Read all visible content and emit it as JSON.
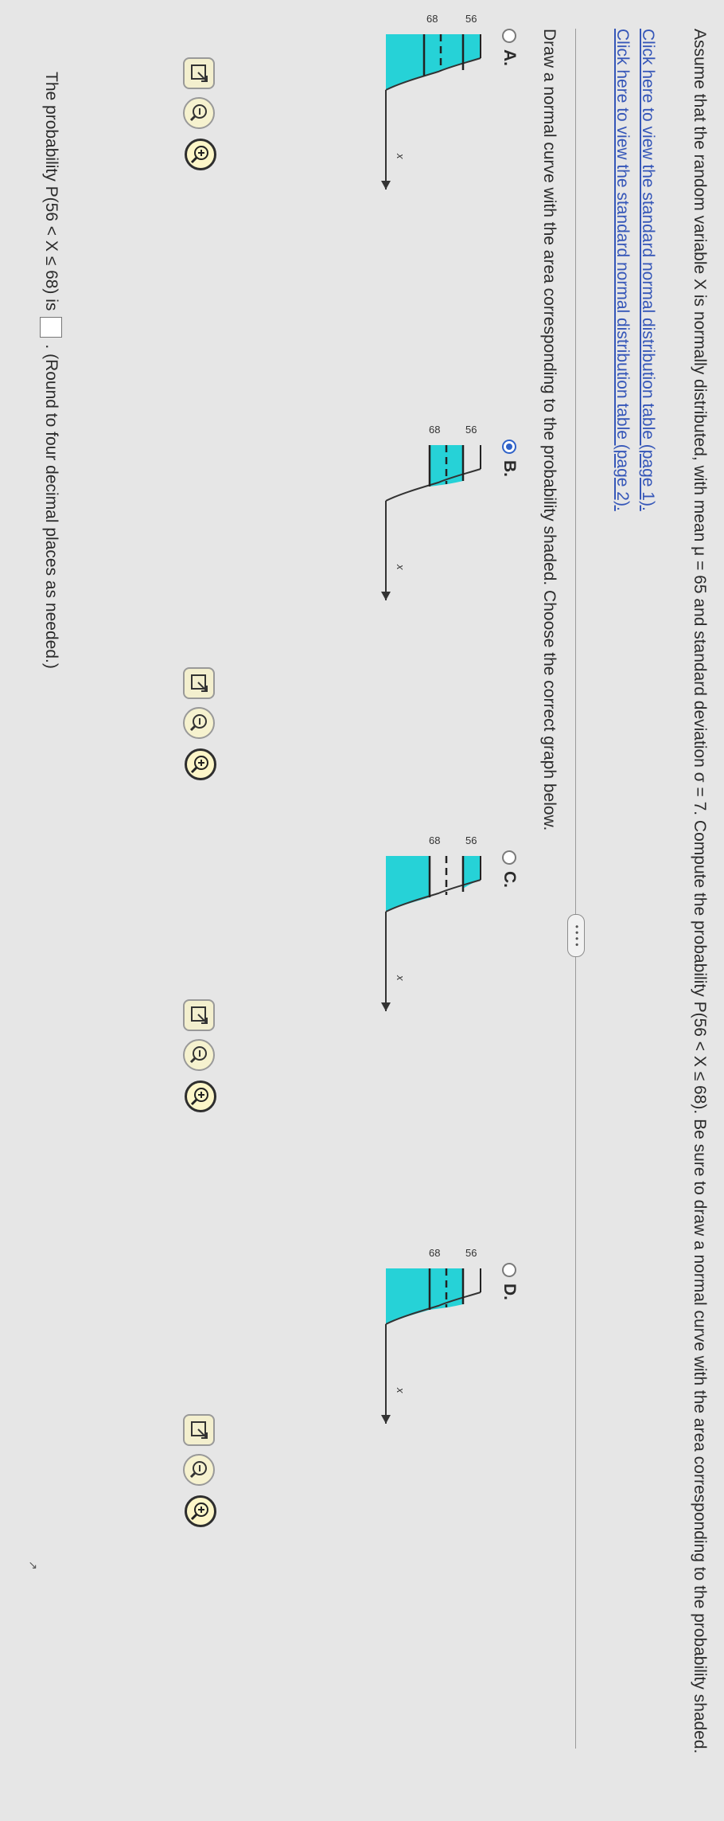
{
  "question": {
    "prefix": "Assume that the random variable X is normally distributed, with mean μ = 65 and standard deviation σ = 7. Compute the probability",
    "expression": "P(56 < X ≤ 68).",
    "suffix": "Be sure to draw a normal curve with the area corresponding to the probability shaded."
  },
  "links": [
    {
      "label": "Click here to view the standard normal distribution table (page 1)."
    },
    {
      "label": "Click here to view the standard normal distribution table (page 2)."
    }
  ],
  "divider_handle": "• • • •",
  "instruction": "Draw a normal curve with the area corresponding to the probability shaded. Choose the correct graph below.",
  "options": [
    {
      "label": "A.",
      "selected": false,
      "shading": "left-of-56",
      "axis_label": "x",
      "ticks": [
        "56",
        "68"
      ]
    },
    {
      "label": "B.",
      "selected": true,
      "shading": "between-56-and-68",
      "axis_label": "x",
      "ticks": [
        "56",
        "68"
      ]
    },
    {
      "label": "C.",
      "selected": false,
      "shading": "outside-56-and-68",
      "axis_label": "x",
      "ticks": [
        "56",
        "68"
      ]
    },
    {
      "label": "D.",
      "selected": false,
      "shading": "left-of-68",
      "axis_label": "x",
      "ticks": [
        "56",
        "68"
      ]
    }
  ],
  "tool_icons": [
    "zoom-in-icon",
    "zoom-out-icon",
    "popout-icon"
  ],
  "answer": {
    "prefix": "The probability P(56 < X ≤ 68) is",
    "value": "",
    "suffix": ". (Round to four decimal places as needed.)"
  },
  "stray_mark": "↗",
  "colors": {
    "shade": "#26d2d7",
    "link": "#3556b8",
    "radio_selected": "#2f62c8",
    "zoom_bg": "#fdf6c8"
  }
}
